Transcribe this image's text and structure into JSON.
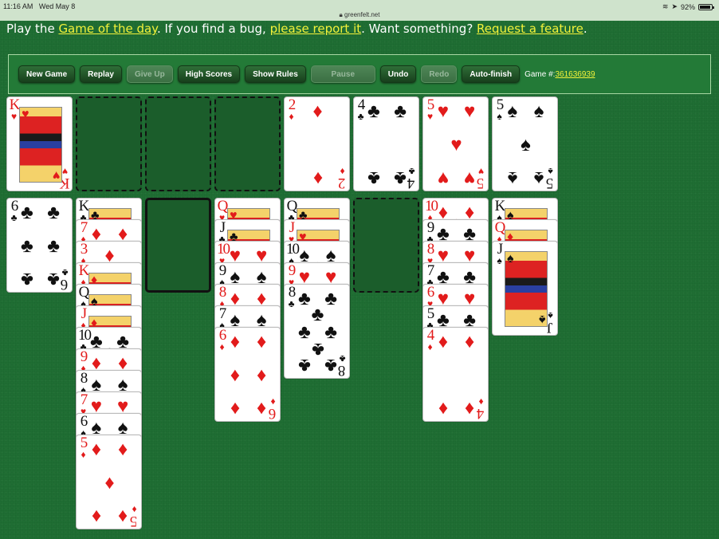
{
  "status_bar": {
    "time": "11:16 AM",
    "date": "Wed May 8",
    "url": "greenfelt.net",
    "battery": "92%",
    "battery_level": 0.92
  },
  "banner": {
    "prefix": "Play the ",
    "link1": "Game of the day",
    "mid1": ". If you find a bug, ",
    "link2": "please report it",
    "mid2": ". Want something? ",
    "link3": "Request a feature",
    "suffix": "."
  },
  "toolbar": {
    "buttons": [
      {
        "label": "New Game",
        "disabled": false
      },
      {
        "label": "Replay",
        "disabled": false
      },
      {
        "label": "Give Up",
        "disabled": true
      },
      {
        "label": "High Scores",
        "disabled": false
      },
      {
        "label": "Show Rules",
        "disabled": false
      },
      {
        "label": "Pause",
        "disabled": true
      },
      {
        "label": "Undo",
        "disabled": false
      },
      {
        "label": "Redo",
        "disabled": true
      },
      {
        "label": "Auto-finish",
        "disabled": false
      }
    ],
    "game_label": "Game #:",
    "game_number": "361636939"
  },
  "colors": {
    "felt": "#1f6e33",
    "link": "#f2f23a",
    "red_suit": "#e21b1b",
    "black_suit": "#111111"
  },
  "freecells": [
    {
      "rank": "K",
      "suit": "hearts"
    },
    null,
    null,
    null
  ],
  "foundations": [
    {
      "rank": "2",
      "suit": "diamonds"
    },
    {
      "rank": "4",
      "suit": "clubs"
    },
    {
      "rank": "5",
      "suit": "hearts"
    },
    {
      "rank": "5",
      "suit": "spades"
    }
  ],
  "tableau": [
    [
      {
        "rank": "6",
        "suit": "clubs"
      }
    ],
    [
      {
        "rank": "K",
        "suit": "clubs"
      },
      {
        "rank": "7",
        "suit": "diamonds"
      },
      {
        "rank": "3",
        "suit": "diamonds"
      },
      {
        "rank": "K",
        "suit": "diamonds"
      },
      {
        "rank": "Q",
        "suit": "spades"
      },
      {
        "rank": "J",
        "suit": "diamonds"
      },
      {
        "rank": "10",
        "suit": "clubs"
      },
      {
        "rank": "9",
        "suit": "diamonds"
      },
      {
        "rank": "8",
        "suit": "spades"
      },
      {
        "rank": "7",
        "suit": "hearts"
      },
      {
        "rank": "6",
        "suit": "spades"
      },
      {
        "rank": "5",
        "suit": "diamonds"
      }
    ],
    [],
    [
      {
        "rank": "Q",
        "suit": "hearts"
      },
      {
        "rank": "J",
        "suit": "clubs"
      },
      {
        "rank": "10",
        "suit": "hearts"
      },
      {
        "rank": "9",
        "suit": "spades"
      },
      {
        "rank": "8",
        "suit": "diamonds"
      },
      {
        "rank": "7",
        "suit": "spades"
      },
      {
        "rank": "6",
        "suit": "diamonds"
      }
    ],
    [
      {
        "rank": "Q",
        "suit": "clubs"
      },
      {
        "rank": "J",
        "suit": "hearts"
      },
      {
        "rank": "10",
        "suit": "spades"
      },
      {
        "rank": "9",
        "suit": "hearts"
      },
      {
        "rank": "8",
        "suit": "clubs"
      }
    ],
    [],
    [
      {
        "rank": "10",
        "suit": "diamonds"
      },
      {
        "rank": "9",
        "suit": "clubs"
      },
      {
        "rank": "8",
        "suit": "hearts"
      },
      {
        "rank": "7",
        "suit": "clubs"
      },
      {
        "rank": "6",
        "suit": "hearts"
      },
      {
        "rank": "5",
        "suit": "clubs"
      },
      {
        "rank": "4",
        "suit": "diamonds"
      }
    ],
    [
      {
        "rank": "K",
        "suit": "spades"
      },
      {
        "rank": "Q",
        "suit": "diamonds"
      },
      {
        "rank": "J",
        "suit": "spades"
      }
    ]
  ]
}
